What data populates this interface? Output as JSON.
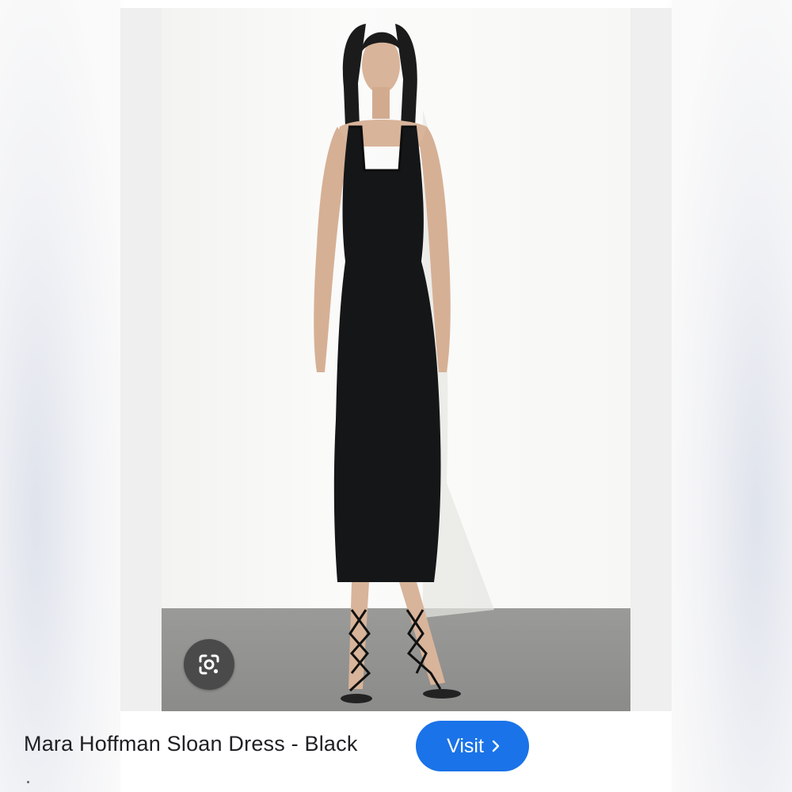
{
  "product": {
    "title": "Mara Hoffman Sloan Dress - Black",
    "visit_label": "Visit"
  },
  "icons": {
    "lens": "google-lens-icon",
    "visit_chevron": "chevron-right-icon"
  },
  "colors": {
    "visit_button": "#1a73e8",
    "lens_button": "#4a4a4a",
    "dress": "#151618"
  }
}
